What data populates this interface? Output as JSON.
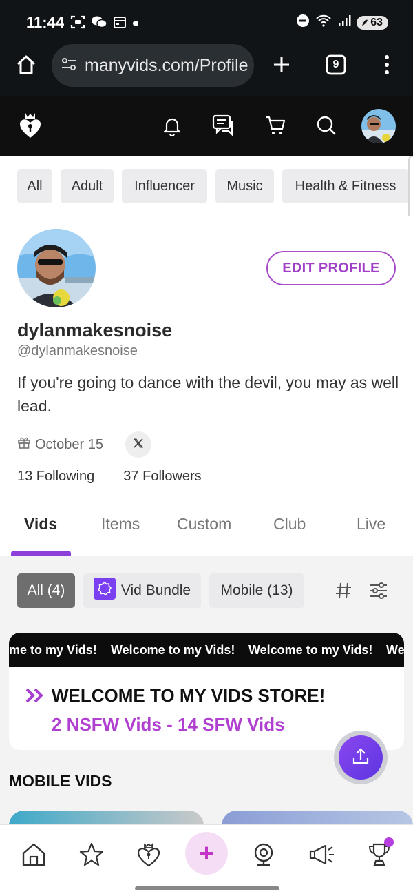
{
  "status_bar": {
    "time": "11:44",
    "battery": "63",
    "icons": [
      "screenshot-icon",
      "wechat-icon",
      "calendar-icon",
      "dot-icon",
      "dnd-icon",
      "wifi-icon",
      "signal-icon",
      "battery-icon"
    ]
  },
  "browser": {
    "url": "manyvids.com/Profile",
    "tab_count": "9"
  },
  "header": {
    "icons": [
      "logo-icon",
      "bell-icon",
      "chat-icon",
      "cart-icon",
      "search-icon",
      "avatar"
    ]
  },
  "categories": [
    "All",
    "Adult",
    "Influencer",
    "Music",
    "Health & Fitness"
  ],
  "profile": {
    "display_name": "dylanmakesnoise",
    "handle": "@dylanmakesnoise",
    "bio": "If you're going to dance with the devil, you may as well lead.",
    "birthday": "October 15",
    "following": "13 Following",
    "followers": "37 Followers",
    "edit_label": "EDIT PROFILE"
  },
  "tabs": [
    "Vids",
    "Items",
    "Custom",
    "Club",
    "Live"
  ],
  "filters": {
    "all": "All (4)",
    "bundle": "Vid Bundle",
    "mobile": "Mobile (13)"
  },
  "welcome": {
    "marquee": [
      "me to my Vids!",
      "Welcome to my Vids!",
      "Welcome to my Vids!",
      "We"
    ],
    "title": "WELCOME TO MY VIDS STORE!",
    "subtitle": "2 NSFW Vids - 14 SFW Vids"
  },
  "section_title": "MOBILE VIDS",
  "bottom_nav": {
    "plus": "+"
  },
  "colors": {
    "accent": "#a23fc8",
    "tab_underline": "#8e3fd9",
    "header_bg": "#0f0f10"
  }
}
